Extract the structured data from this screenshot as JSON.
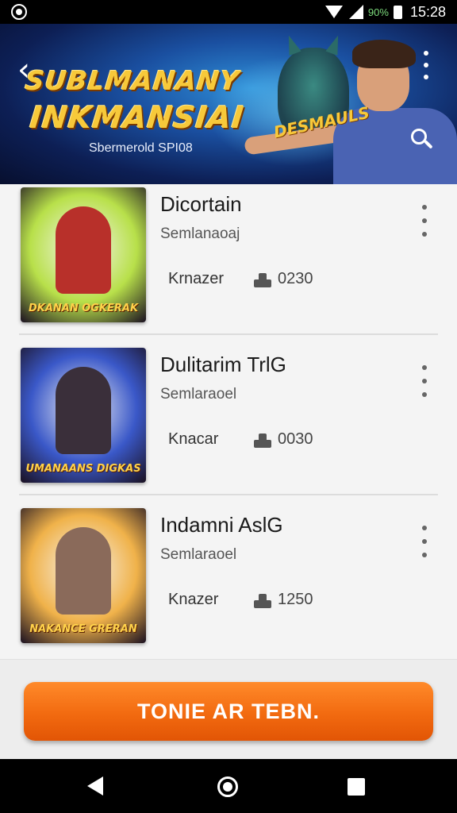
{
  "status_bar": {
    "battery_text": "90%",
    "time": "15:28"
  },
  "banner": {
    "title_line1": "SUBLMANANY",
    "title_line2": "INKMANSIAI",
    "subtitle": "Sbermerold SPI08",
    "badge": "DESMAULS"
  },
  "games": [
    {
      "title": "Dicortain",
      "subtitle": "Semlanaoaj",
      "author": "Krnazer",
      "stat": "0230",
      "thumb_caption": "DKANAN OGKERAK",
      "thumb_bg": "#b8e04a",
      "thumb_figure": "#b8302a"
    },
    {
      "title": "Dulitarim TrlG",
      "subtitle": "Semlaraoel",
      "author": "Knacar",
      "stat": "0030",
      "thumb_caption": "UMANAANS DIGKAS",
      "thumb_bg": "#3a58c8",
      "thumb_figure": "#3a2f3a"
    },
    {
      "title": "Indamni AslG",
      "subtitle": "Semlaraoel",
      "author": "Knazer",
      "stat": "1250",
      "thumb_caption": "NAKANCE GRERAN",
      "thumb_bg": "#f0b24a",
      "thumb_figure": "#8a6a5a"
    }
  ],
  "cta": {
    "label": "TONIE AR TEBN."
  }
}
